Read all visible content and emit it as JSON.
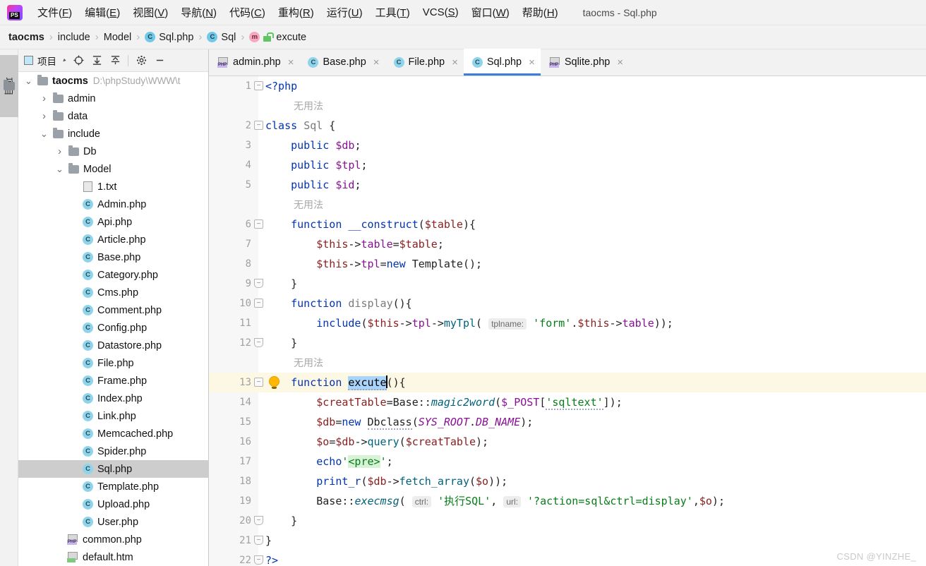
{
  "window": {
    "title": "taocms - Sql.php",
    "logo_icon": "phpstorm-logo-icon"
  },
  "menubar": {
    "items": [
      {
        "label": "文件",
        "mnemonic": "F"
      },
      {
        "label": "编辑",
        "mnemonic": "E"
      },
      {
        "label": "视图",
        "mnemonic": "V"
      },
      {
        "label": "导航",
        "mnemonic": "N"
      },
      {
        "label": "代码",
        "mnemonic": "C"
      },
      {
        "label": "重构",
        "mnemonic": "R"
      },
      {
        "label": "运行",
        "mnemonic": "U"
      },
      {
        "label": "工具",
        "mnemonic": "T"
      },
      {
        "label": "VCS",
        "mnemonic": "S"
      },
      {
        "label": "窗口",
        "mnemonic": "W"
      },
      {
        "label": "帮助",
        "mnemonic": "H"
      }
    ]
  },
  "breadcrumb": {
    "separator": "›",
    "items": [
      {
        "label": "taocms",
        "icon": ""
      },
      {
        "label": "include",
        "icon": ""
      },
      {
        "label": "Model",
        "icon": ""
      },
      {
        "label": "Sql.php",
        "icon": "class-badge-icon",
        "badge": "C"
      },
      {
        "label": "Sql",
        "icon": "class-badge-icon",
        "badge": "C"
      },
      {
        "label": "excute",
        "icon": "method-badge-icon",
        "badge": "m",
        "lock": "unlocked-padlock-icon"
      }
    ]
  },
  "left_strip": {
    "tab_label": "项目",
    "folder_icon": "folder-icon"
  },
  "project_panel": {
    "toolbar": {
      "title": "项目",
      "icons": [
        {
          "name": "select-opened-file-icon",
          "glyph": "⊕"
        },
        {
          "name": "expand-all-icon",
          "glyph": "↧"
        },
        {
          "name": "collapse-all-icon",
          "glyph": "↥"
        },
        {
          "name": "settings-gear-icon",
          "glyph": "⚙"
        },
        {
          "name": "hide-panel-icon",
          "glyph": "—"
        }
      ]
    },
    "tree": [
      {
        "label": "taocms",
        "path": "D:\\phpStudy\\WWW\\t",
        "icon": "folder-icon",
        "arrow": "expanded",
        "indent": 0,
        "bold": true
      },
      {
        "label": "admin",
        "icon": "folder-icon",
        "arrow": "collapsed",
        "indent": 1
      },
      {
        "label": "data",
        "icon": "folder-icon",
        "arrow": "collapsed",
        "indent": 1
      },
      {
        "label": "include",
        "icon": "folder-icon",
        "arrow": "expanded",
        "indent": 1
      },
      {
        "label": "Db",
        "icon": "folder-icon",
        "arrow": "collapsed",
        "indent": 2
      },
      {
        "label": "Model",
        "icon": "folder-icon",
        "arrow": "expanded",
        "indent": 2
      },
      {
        "label": "1.txt",
        "icon": "text-file-icon",
        "indent": 3
      },
      {
        "label": "Admin.php",
        "icon": "php-class-icon",
        "indent": 3
      },
      {
        "label": "Api.php",
        "icon": "php-class-icon",
        "indent": 3
      },
      {
        "label": "Article.php",
        "icon": "php-class-icon",
        "indent": 3
      },
      {
        "label": "Base.php",
        "icon": "php-class-icon",
        "indent": 3
      },
      {
        "label": "Category.php",
        "icon": "php-class-icon",
        "indent": 3
      },
      {
        "label": "Cms.php",
        "icon": "php-class-icon",
        "indent": 3
      },
      {
        "label": "Comment.php",
        "icon": "php-class-icon",
        "indent": 3
      },
      {
        "label": "Config.php",
        "icon": "php-class-icon",
        "indent": 3
      },
      {
        "label": "Datastore.php",
        "icon": "php-class-icon",
        "indent": 3
      },
      {
        "label": "File.php",
        "icon": "php-class-icon",
        "indent": 3
      },
      {
        "label": "Frame.php",
        "icon": "php-class-icon",
        "indent": 3
      },
      {
        "label": "Index.php",
        "icon": "php-class-icon",
        "indent": 3
      },
      {
        "label": "Link.php",
        "icon": "php-class-icon",
        "indent": 3
      },
      {
        "label": "Memcached.php",
        "icon": "php-class-icon",
        "indent": 3
      },
      {
        "label": "Spider.php",
        "icon": "php-class-icon",
        "indent": 3
      },
      {
        "label": "Sql.php",
        "icon": "php-class-icon",
        "indent": 3,
        "selected": true
      },
      {
        "label": "Template.php",
        "icon": "php-class-icon",
        "indent": 3
      },
      {
        "label": "Upload.php",
        "icon": "php-class-icon",
        "indent": 3
      },
      {
        "label": "User.php",
        "icon": "php-class-icon",
        "indent": 3
      },
      {
        "label": "common.php",
        "icon": "php-file-icon",
        "indent": 2
      },
      {
        "label": "default.htm",
        "icon": "html-file-icon",
        "indent": 2
      }
    ]
  },
  "editor_tabs": [
    {
      "label": "admin.php",
      "icon": "php-file-icon",
      "active": false,
      "close": "×"
    },
    {
      "label": "Base.php",
      "icon": "php-class-icon",
      "active": false,
      "close": "×"
    },
    {
      "label": "File.php",
      "icon": "php-class-icon",
      "active": false,
      "close": "×"
    },
    {
      "label": "Sql.php",
      "icon": "php-class-icon",
      "active": true,
      "close": "×"
    },
    {
      "label": "Sqlite.php",
      "icon": "php-file-icon",
      "active": false,
      "close": "×"
    }
  ],
  "editor": {
    "active_file": "Sql.php",
    "language": "PHP",
    "inlay_hints": [
      {
        "text": "无用法",
        "after_line": 1
      },
      {
        "text": "无用法",
        "after_line": 5
      },
      {
        "text": "无用法",
        "after_line": 12
      }
    ],
    "lines": [
      {
        "num": 1,
        "text": "<?php",
        "fold": "minus"
      },
      {
        "num": 2,
        "text": "class Sql {",
        "fold": "minus"
      },
      {
        "num": 3,
        "text": "    public $db;"
      },
      {
        "num": 4,
        "text": "    public $tpl;"
      },
      {
        "num": 5,
        "text": "    public $id;"
      },
      {
        "num": 6,
        "text": "    function __construct($table){",
        "fold": "minus"
      },
      {
        "num": 7,
        "text": "        $this->table=$table;"
      },
      {
        "num": 8,
        "text": "        $this->tpl=new Template();"
      },
      {
        "num": 9,
        "text": "    }",
        "fold": "end"
      },
      {
        "num": 10,
        "text": "    function display(){",
        "fold": "minus"
      },
      {
        "num": 11,
        "text": "        include($this->tpl->myTpl( tplname: 'form'.$this->table));"
      },
      {
        "num": 12,
        "text": "    }",
        "fold": "end"
      },
      {
        "num": 13,
        "text": "    function excute(){",
        "fold": "minus",
        "highlighted": true,
        "bulb": true,
        "selection": "excute"
      },
      {
        "num": 14,
        "text": "        $creatTable=Base::magic2word($_POST['sqltext']);"
      },
      {
        "num": 15,
        "text": "        $db=new Dbclass(SYS_ROOT.DB_NAME);"
      },
      {
        "num": 16,
        "text": "        $o=$db->query($creatTable);"
      },
      {
        "num": 17,
        "text": "        echo'<pre>';"
      },
      {
        "num": 18,
        "text": "        print_r($db->fetch_array($o));"
      },
      {
        "num": 19,
        "text": "        Base::execmsg( ctrl: '执行SQL', url: '?action=sql&ctrl=display',$o);"
      },
      {
        "num": 20,
        "text": "    }",
        "fold": "end"
      },
      {
        "num": 21,
        "text": "}",
        "fold": "end"
      },
      {
        "num": 22,
        "text": "?>",
        "fold": "end"
      }
    ],
    "parameter_hints": [
      {
        "line": 11,
        "name": "tplname"
      },
      {
        "line": 19,
        "name": "ctrl"
      },
      {
        "line": 19,
        "name": "url"
      }
    ],
    "caret_line": 13,
    "selected_text": "excute"
  },
  "watermark": "CSDN @YINZHE_",
  "colors": {
    "accent": "#3b7dd8",
    "selection": "#a9d4fb",
    "highlight_line": "#fdf8e3",
    "keyword": "#0033b3",
    "variable": "#871094",
    "string": "#067d17",
    "constant": "#871094",
    "tree_selected": "#cdcdcd"
  }
}
